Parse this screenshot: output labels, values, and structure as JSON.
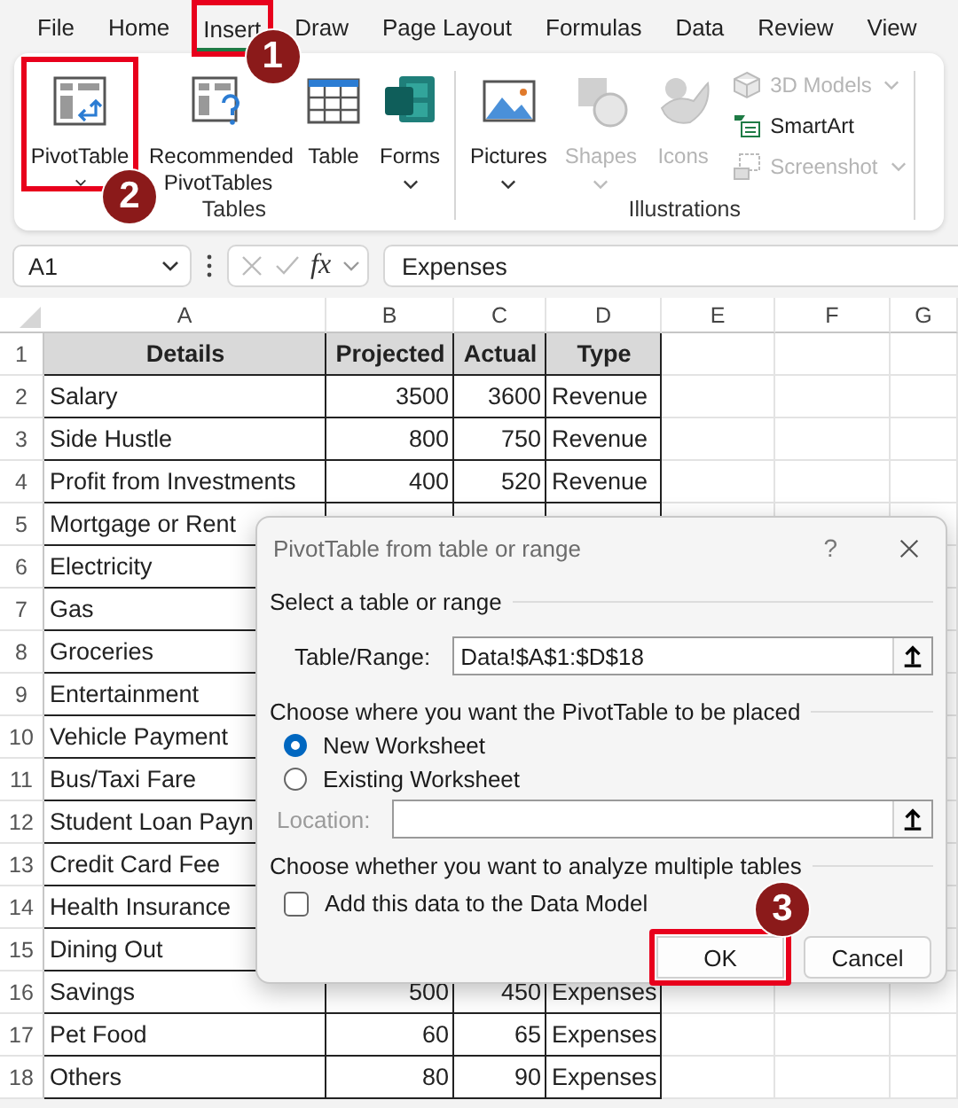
{
  "ribbon_tabs": [
    {
      "label": "File",
      "selected": false,
      "highlighted": false
    },
    {
      "label": "Home",
      "selected": false,
      "highlighted": false
    },
    {
      "label": "Insert",
      "selected": true,
      "highlighted": true,
      "callout": "1"
    },
    {
      "label": "Draw",
      "selected": false,
      "highlighted": false
    },
    {
      "label": "Page Layout",
      "selected": false,
      "highlighted": false
    },
    {
      "label": "Formulas",
      "selected": false,
      "highlighted": false
    },
    {
      "label": "Data",
      "selected": false,
      "highlighted": false
    },
    {
      "label": "Review",
      "selected": false,
      "highlighted": false
    },
    {
      "label": "View",
      "selected": false,
      "highlighted": false
    }
  ],
  "ribbon_groups": [
    {
      "label": "Tables",
      "items": [
        {
          "label": "PivotTable",
          "dropdown": true,
          "disabled": false,
          "highlighted": true,
          "callout": "2"
        },
        {
          "label": "Recommended PivotTables",
          "dropdown": false,
          "disabled": false,
          "highlighted": false
        },
        {
          "label": "Table",
          "dropdown": false,
          "disabled": false,
          "highlighted": false
        },
        {
          "label": "Forms",
          "dropdown": true,
          "disabled": false,
          "highlighted": false
        }
      ]
    },
    {
      "label": "Illustrations",
      "items": [
        {
          "label": "Pictures",
          "dropdown": true,
          "disabled": false
        },
        {
          "label": "Shapes",
          "dropdown": true,
          "disabled": true
        },
        {
          "label": "Icons",
          "dropdown": false,
          "disabled": true
        },
        {
          "label": "3D Models",
          "dropdown": true,
          "disabled": true
        },
        {
          "label": "SmartArt",
          "dropdown": false,
          "disabled": false
        },
        {
          "label": "Screenshot",
          "dropdown": true,
          "disabled": true
        }
      ]
    }
  ],
  "formula_bar": {
    "name_box": "A1",
    "function_label": "fx",
    "formula": "Expenses"
  },
  "columns": [
    "A",
    "B",
    "C",
    "D",
    "E",
    "F",
    "G"
  ],
  "rows": [
    {
      "number": "1",
      "kind": "header",
      "cells": [
        "Details",
        "Projected",
        "Actual",
        "Type"
      ]
    },
    {
      "number": "2",
      "kind": "data",
      "cells": [
        "Salary",
        "3500",
        "3600",
        "Revenue"
      ]
    },
    {
      "number": "3",
      "kind": "data",
      "cells": [
        "Side Hustle",
        "800",
        "750",
        "Revenue"
      ]
    },
    {
      "number": "4",
      "kind": "data",
      "cells": [
        "Profit from Investments",
        "400",
        "520",
        "Revenue"
      ]
    },
    {
      "number": "5",
      "kind": "data",
      "cells": [
        "Mortgage or Rent"
      ]
    },
    {
      "number": "6",
      "kind": "data",
      "cells": [
        "Electricity"
      ]
    },
    {
      "number": "7",
      "kind": "data",
      "cells": [
        "Gas"
      ]
    },
    {
      "number": "8",
      "kind": "data",
      "cells": [
        "Groceries"
      ]
    },
    {
      "number": "9",
      "kind": "data",
      "cells": [
        "Entertainment"
      ]
    },
    {
      "number": "10",
      "kind": "data",
      "cells": [
        "Vehicle Payment"
      ]
    },
    {
      "number": "11",
      "kind": "data",
      "cells": [
        "Bus/Taxi Fare"
      ]
    },
    {
      "number": "12",
      "kind": "data",
      "cells": [
        "Student Loan Payn"
      ]
    },
    {
      "number": "13",
      "kind": "data",
      "cells": [
        "Credit Card Fee"
      ]
    },
    {
      "number": "14",
      "kind": "data",
      "cells": [
        "Health Insurance"
      ]
    },
    {
      "number": "15",
      "kind": "data",
      "cells": [
        "Dining Out"
      ]
    },
    {
      "number": "16",
      "kind": "data",
      "cells": [
        "Savings",
        "500",
        "450",
        "Expenses"
      ]
    },
    {
      "number": "17",
      "kind": "data",
      "cells": [
        "Pet Food",
        "60",
        "65",
        "Expenses"
      ]
    },
    {
      "number": "18",
      "kind": "data",
      "cells": [
        "Others",
        "80",
        "90",
        "Expenses"
      ]
    }
  ],
  "dialog": {
    "title": "PivotTable from table or range",
    "help_button": "?",
    "section_1": "Select a table or range",
    "range_label": "Table/Range:",
    "range_value": "Data!$A$1:$D$18",
    "section_2": "Choose where you want the PivotTable to be placed",
    "placement_options": [
      {
        "label": "New Worksheet",
        "selected": true
      },
      {
        "label": "Existing Worksheet",
        "selected": false
      }
    ],
    "location_label": "Location:",
    "location_disabled": true,
    "section_3": "Choose whether you want to analyze multiple tables",
    "data_model": {
      "label": "Add this data to the Data Model",
      "checked": false
    },
    "buttons": [
      {
        "label": "OK",
        "highlighted": true,
        "callout": "3"
      },
      {
        "label": "Cancel",
        "highlighted": false
      }
    ]
  }
}
